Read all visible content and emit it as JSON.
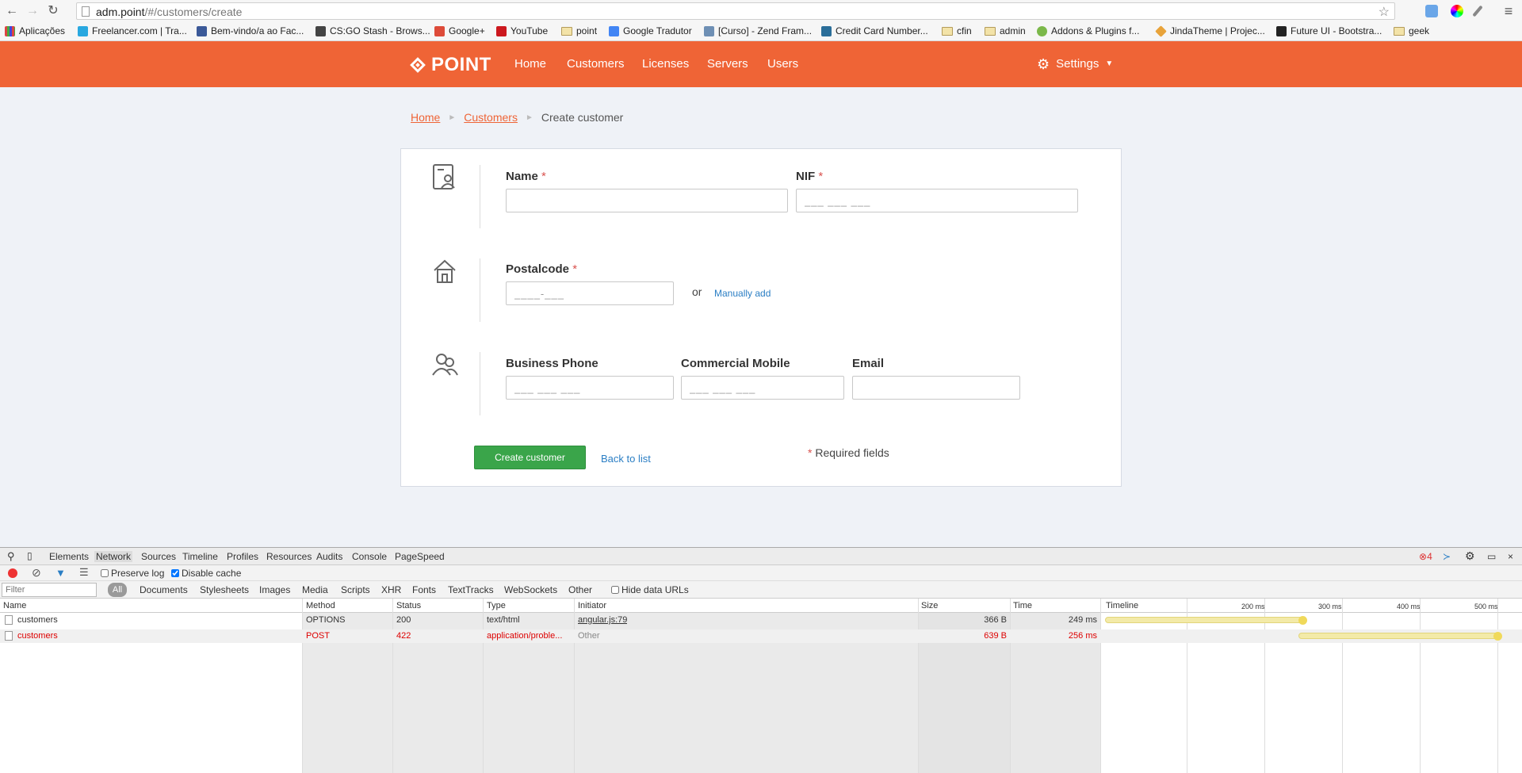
{
  "browser": {
    "url_host": "adm.point",
    "url_path": "/#/customers/create",
    "bookmarks": [
      {
        "label": "Aplicações",
        "icon": "apps-grid-icon"
      },
      {
        "label": "Freelancer.com | Tra...",
        "icon": "freelancer-icon"
      },
      {
        "label": "Bem-vindo/a ao Fac...",
        "icon": "facebook-icon"
      },
      {
        "label": "CS:GO Stash - Brows...",
        "icon": "csgo-icon"
      },
      {
        "label": "Google+",
        "icon": "google-plus-icon"
      },
      {
        "label": "YouTube",
        "icon": "youtube-icon"
      },
      {
        "label": "point",
        "icon": "folder-icon"
      },
      {
        "label": "Google Tradutor",
        "icon": "translate-icon"
      },
      {
        "label": "[Curso] - Zend Fram...",
        "icon": "course-icon"
      },
      {
        "label": "Credit Card Number...",
        "icon": "credit-card-icon"
      },
      {
        "label": "cfin",
        "icon": "folder-icon"
      },
      {
        "label": "admin",
        "icon": "folder-icon"
      },
      {
        "label": "Addons & Plugins f...",
        "icon": "leaf-icon"
      },
      {
        "label": "JindaTheme | Projec...",
        "icon": "diamond-icon"
      },
      {
        "label": "Future UI - Bootstra...",
        "icon": "future-ui-icon"
      },
      {
        "label": "geek",
        "icon": "folder-icon"
      }
    ]
  },
  "header": {
    "brand": "POINT",
    "nav": [
      "Home",
      "Customers",
      "Licenses",
      "Servers",
      "Users"
    ],
    "settings_label": "Settings",
    "accent": "#ef6436"
  },
  "breadcrumb": {
    "home": "Home",
    "customers": "Customers",
    "current": "Create customer"
  },
  "form": {
    "name_label": "Name",
    "nif_label": "NIF",
    "nif_placeholder": "___ ___ ___",
    "postalcode_label": "Postalcode",
    "postalcode_placeholder": "____-___",
    "or_text": "or",
    "manual_add": "Manually add",
    "business_phone_label": "Business Phone",
    "business_phone_placeholder": "___ ___ ___",
    "commercial_mobile_label": "Commercial Mobile",
    "commercial_mobile_placeholder": "___ ___ ___",
    "email_label": "Email",
    "required_mark": "*",
    "create_button": "Create customer",
    "back_link": "Back to list",
    "required_note": "Required fields"
  },
  "devtools": {
    "tabs": [
      "Elements",
      "Network",
      "Sources",
      "Timeline",
      "Profiles",
      "Resources",
      "Audits",
      "Console",
      "PageSpeed"
    ],
    "active_tab": "Network",
    "error_count": "4",
    "preserve_log": "Preserve log",
    "disable_cache": "Disable cache",
    "filter_placeholder": "Filter",
    "filter_all": "All",
    "filter_types": [
      "Documents",
      "Stylesheets",
      "Images",
      "Media",
      "Scripts",
      "XHR",
      "Fonts",
      "TextTracks",
      "WebSockets",
      "Other"
    ],
    "hide_data_urls": "Hide data URLs",
    "columns": [
      "Name",
      "Method",
      "Status",
      "Type",
      "Initiator",
      "Size",
      "Time",
      "Timeline"
    ],
    "timeline_ticks": [
      "200 ms",
      "300 ms",
      "400 ms",
      "500 ms"
    ],
    "rows": [
      {
        "name": "customers",
        "method": "OPTIONS",
        "status": "200",
        "type": "text/html",
        "initiator": "angular.js:79",
        "size": "366 B",
        "time": "249 ms",
        "error": false
      },
      {
        "name": "customers",
        "method": "POST",
        "status": "422",
        "type": "application/proble...",
        "initiator": "Other",
        "size": "639 B",
        "time": "256 ms",
        "error": true
      }
    ]
  }
}
